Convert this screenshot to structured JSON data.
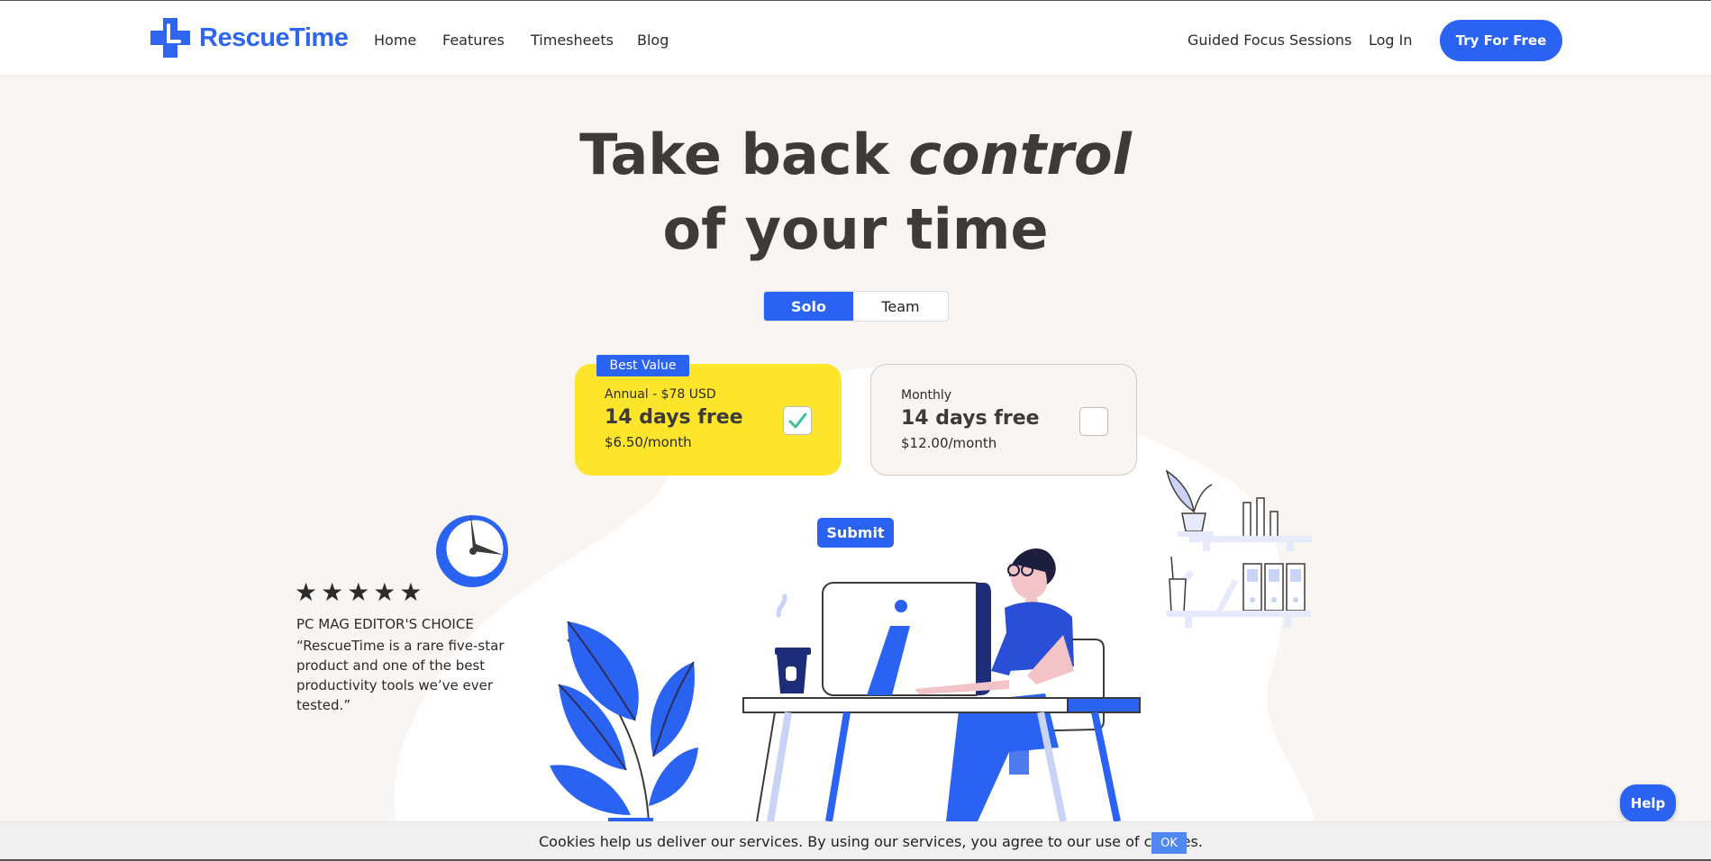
{
  "header": {
    "logo_text": "RescueTime",
    "nav": [
      "Home",
      "Features",
      "Timesheets",
      "Blog"
    ],
    "right_links": [
      "Guided Focus Sessions",
      "Log In"
    ],
    "cta": "Try For Free"
  },
  "hero": {
    "title_part1": "Take back ",
    "title_emphasis": "control",
    "title_line2": "of your time"
  },
  "toggle": {
    "solo": "Solo",
    "team": "Team",
    "selected": "Solo"
  },
  "plans": {
    "badge": "Best Value",
    "annual": {
      "label": "Annual - $78 USD",
      "headline": "14 days free",
      "price": "$6.50/month",
      "checked": true
    },
    "monthly": {
      "label": "Monthly",
      "headline": "14 days free",
      "price": "$12.00/month",
      "checked": false
    }
  },
  "submit": "Submit",
  "review": {
    "stars": "★★★★★",
    "source": "PC MAG EDITOR'S CHOICE",
    "quote": "“RescueTime is a rare five-star product and one of the best productivity tools we’ve ever tested.”"
  },
  "cookie": {
    "text": "Cookies help us deliver our services. By using our services, you agree to our use of cookies.",
    "ok": "OK"
  },
  "help": "Help",
  "colors": {
    "brand_blue": "#2a63f1",
    "yellow": "#fde52b",
    "background": "#f8f5f2"
  },
  "icons": [
    "rescuetime-logo-icon",
    "checkmark-icon",
    "clock-icon",
    "plant-illustration",
    "desk-illustration",
    "shelf-illustration"
  ]
}
